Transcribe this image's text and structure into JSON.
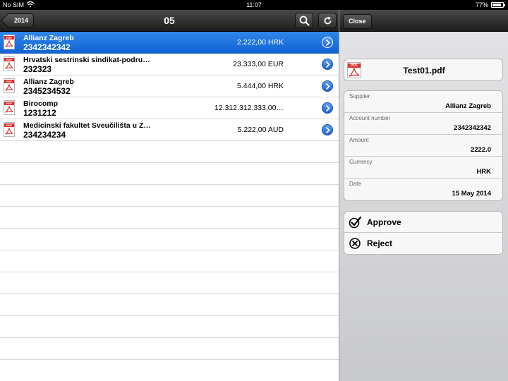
{
  "status_bar": {
    "carrier": "No SIM",
    "time": "11:07",
    "battery": "77%"
  },
  "left_nav": {
    "back_label": "2014",
    "title": "05"
  },
  "documents": [
    {
      "name": "Allianz Zagreb",
      "account": "2342342342",
      "amount": "2.222,00 HRK",
      "selected": true
    },
    {
      "name": "Hrvatski sestrinski sindikat-podru…",
      "account": "232323",
      "amount": "23.333,00 EUR",
      "selected": false
    },
    {
      "name": "Allianz Zagreb",
      "account": "2345234532",
      "amount": "5.444,00 HRK",
      "selected": false
    },
    {
      "name": "Birocomp",
      "account": "1231212",
      "amount": "12.312.312.333,00…",
      "selected": false
    },
    {
      "name": "Medicinski fakultet Sveučilišta u Z…",
      "account": "234234234",
      "amount": "5.222,00 AUD",
      "selected": false
    }
  ],
  "detail": {
    "close_label": "Close",
    "file_name": "Test01.pdf",
    "pdf_badge": "PDF",
    "fields": [
      {
        "label": "Supplier",
        "value": "Allianz Zagreb"
      },
      {
        "label": "Account number",
        "value": "2342342342"
      },
      {
        "label": "Amount",
        "value": "2222.0"
      },
      {
        "label": "Currency",
        "value": "HRK"
      },
      {
        "label": "Date",
        "value": "15 May 2014"
      }
    ],
    "actions": [
      {
        "label": "Approve",
        "icon": "checkmark-icon"
      },
      {
        "label": "Reject",
        "icon": "x-circle-icon"
      }
    ]
  },
  "colors": {
    "selection": "#1a72e0",
    "disclosure": "#2d74dc",
    "pdf_red": "#d8322d"
  }
}
